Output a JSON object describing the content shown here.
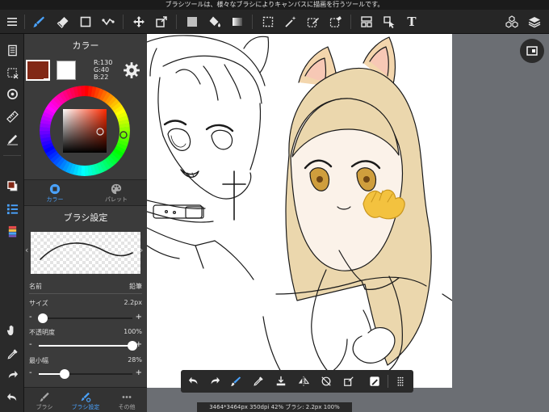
{
  "status_message": "ブラシツールは、様々なブラシによりキャンバスに描画を行うツールです。",
  "colors": {
    "main_color": "#822816",
    "sub_color": "#ffffff",
    "accent": "#4aa3ff"
  },
  "color_panel": {
    "title": "カラー",
    "rgb": {
      "r": "R:130",
      "g": "G:40",
      "b": "B:22"
    },
    "tabs": [
      {
        "label": "カラー",
        "icon": "color-wheel-icon",
        "active": true
      },
      {
        "label": "パレット",
        "icon": "palette-icon",
        "active": false
      }
    ]
  },
  "brush_panel": {
    "title": "ブラシ設定",
    "name_label": "名前",
    "name_value": "鉛筆",
    "size_label": "サイズ",
    "size_value": "2.2px",
    "size_fraction": 0.04,
    "opacity_label": "不透明度",
    "opacity_value": "100%",
    "opacity_fraction": 1.0,
    "min_width_label": "最小幅",
    "min_width_value": "28%",
    "min_width_fraction": 0.28,
    "tabs": [
      {
        "label": "ブラシ",
        "icon": "brush-icon",
        "active": false
      },
      {
        "label": "ブラシ設定",
        "icon": "brush-settings-icon",
        "active": true
      },
      {
        "label": "その他",
        "icon": "more-icon",
        "active": false
      }
    ]
  },
  "bottom_info": "3464*3464px 350dpi 42% ブラシ: 2.2px 100%",
  "toolbar_text_tool": "T"
}
